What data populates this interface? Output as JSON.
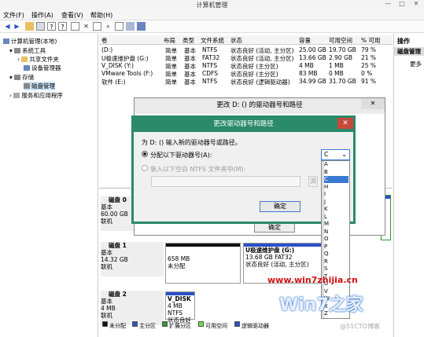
{
  "window": {
    "title": "计算机管理",
    "min": "—",
    "max": "□",
    "close": "✕"
  },
  "menu": [
    "文件(F)",
    "操作(A)",
    "查看(V)",
    "帮助(H)"
  ],
  "tree": {
    "root": "计算机管理(本地)",
    "system_tools": "系统工具",
    "shared_folders": "共享文件夹",
    "device_manager": "设备管理器",
    "storage": "存储",
    "disk_management": "磁盘管理",
    "services": "服务和应用程序"
  },
  "volumes": {
    "headers": [
      "卷",
      "布局",
      "类型",
      "文件系统",
      "状态",
      "容量",
      "可用空间",
      "% 可用"
    ],
    "rows": [
      [
        "(D:)",
        "简单",
        "基本",
        "NTFS",
        "状态良好 (活动, 主分区)",
        "25.00 GB",
        "19.70 GB",
        "79 %"
      ],
      [
        "U极速维护盘 (G:)",
        "简单",
        "基本",
        "FAT32",
        "状态良好 (活动, 主分区)",
        "13.66 GB",
        "2.90 GB",
        "21 %"
      ],
      [
        "V_DISK (Y:)",
        "简单",
        "基本",
        "NTFS",
        "状态良好 (主分区)",
        "4 MB",
        "1 MB",
        "25 %"
      ],
      [
        "VMware Tools (F:)",
        "简单",
        "基本",
        "CDFS",
        "状态良好 (主分区)",
        "83 MB",
        "0 MB",
        "0 %"
      ],
      [
        "软件 (E:)",
        "简单",
        "基本",
        "NTFS",
        "状态良好 (逻辑驱动器)",
        "34.99 GB",
        "31.70 GB",
        "91 %"
      ]
    ]
  },
  "actions": {
    "title": "操作",
    "section": "磁盘管理",
    "more": "更多"
  },
  "disks": {
    "disk0": {
      "name": "磁盘 0",
      "type": "基本",
      "size": "60.00 GB",
      "status": "联机"
    },
    "disk1": {
      "name": "磁盘 1",
      "type": "基本",
      "size": "14.32 GB",
      "status": "联机"
    },
    "disk2": {
      "name": "磁盘 2",
      "type": "基本",
      "size": "4 MB",
      "status": "联机"
    },
    "disk1_unalloc": {
      "size": "658 MB",
      "label": "未分配"
    },
    "disk1_part": {
      "name": "U极速维护盘 (G:)",
      "size": "13.68 GB FAT32",
      "status": "状态良好 (活动, 主分区)"
    },
    "disk2_part": {
      "name": "V_DISK",
      "size": "4 MB NTFS",
      "status": "状态良好"
    }
  },
  "legend": [
    "未分配",
    "主分区",
    "扩展分区",
    "可用空间",
    "逻辑驱动器"
  ],
  "outer_dialog": {
    "title": "更改 D: () 的驱动器号和路径",
    "ok": "确定"
  },
  "inner_dialog": {
    "title": "更改驱动器号和路径",
    "prompt": "为 D: () 输入新的驱动器号或路径。",
    "opt_letter": "分配以下驱动器号(A):",
    "opt_folder": "装入以下空白 NTFS 文件夹中(M):",
    "browse": "浏",
    "ok": "确定",
    "selected": "C"
  },
  "letters": [
    "A",
    "B",
    "C",
    "H",
    "I",
    "J",
    "K",
    "L",
    "M",
    "N",
    "O",
    "P",
    "Q",
    "R",
    "S",
    "T",
    "U",
    "V",
    "W",
    "X",
    "Z"
  ],
  "watermark": {
    "site": "www.win7zhijia.cn",
    "brand": "Win7之家",
    "blog": "@51CTO博客"
  },
  "colors": {
    "primary": "#2a50c8",
    "logical": "#2a50c8",
    "unalloc": "#111111",
    "free": "#6fdc4a",
    "ext": "#2e9a2e",
    "dialog_accent": "#2a8a6a"
  }
}
